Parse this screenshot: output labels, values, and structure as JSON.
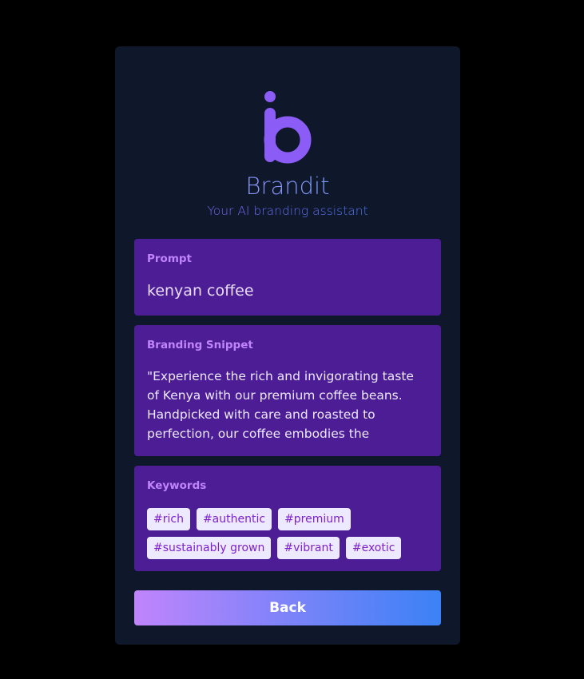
{
  "brand": {
    "name": "Brandit",
    "tagline": "Your AI branding assistant",
    "logo_icon": "brandit-logo-icon",
    "accent_colors": [
      "#8b5cf6",
      "#3b82f6"
    ]
  },
  "prompt": {
    "label": "Prompt",
    "value": "kenyan coffee"
  },
  "snippet": {
    "label": "Branding Snippet",
    "text": "\"Experience the rich and invigorating taste of Kenya with our premium coffee beans. Handpicked with care and roasted to perfection, our coffee embodies the vibrant..."
  },
  "keywords": {
    "label": "Keywords",
    "items": [
      "#rich",
      "#authentic",
      "#premium",
      "#sustainably grown",
      "#vibrant",
      "#exotic"
    ]
  },
  "back_button": {
    "label": "Back"
  }
}
